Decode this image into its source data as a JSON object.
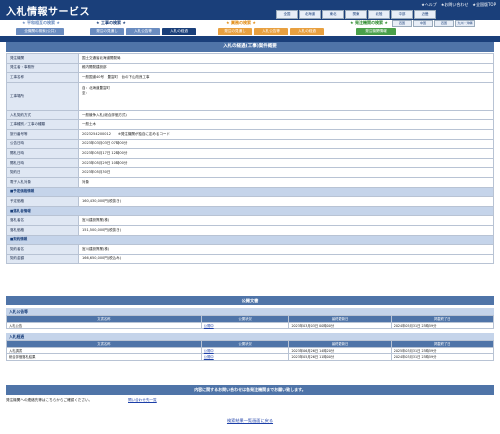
{
  "header": {
    "title": "入札情報サービス",
    "help": "★ヘルプ",
    "inquiry": "★お問い合わせ",
    "home": "★全国版TOP",
    "regions_row1": [
      "全国",
      "北海道",
      "東北",
      "関東",
      "北陸",
      "中部",
      "近畿"
    ],
    "regions_row2": [
      "四国",
      "中国",
      "四国",
      "九州・沖縄"
    ]
  },
  "nav": {
    "groups": [
      {
        "title": "★ 平和相互の検索 ★",
        "color": "#1a3f7a"
      },
      {
        "title": "★ 工事の検索 ★",
        "color": "#1a3f7a"
      },
      {
        "title": "★ 業務の検索 ★",
        "color": "#e08a10"
      },
      {
        "title": "★ 発注機関の検索 ★",
        "color": "#2a8a2a"
      }
    ],
    "tabs": [
      {
        "label": "全機関の検索(公共)",
        "color": "#6a8cc0"
      },
      {
        "label": "発注の見通し",
        "color": "#6a8cc0"
      },
      {
        "label": "入札公告等",
        "color": "#6a8cc0"
      },
      {
        "label": "入札の経過",
        "color": "#1a3f7a"
      },
      {
        "label": "発注の見通し",
        "color": "#e8a040"
      },
      {
        "label": "入札公告等",
        "color": "#e8a040"
      },
      {
        "label": "入札の経過",
        "color": "#e8a040"
      },
      {
        "label": "発注機関情報",
        "color": "#4aa04a"
      }
    ]
  },
  "page_heading": "入札の経過(工事)案件概要",
  "detail_rows": [
    {
      "label": "発注機関",
      "value": "国土交通省北海道開発局"
    },
    {
      "label": "発注者・事務所",
      "value": "稚内開発建設部"
    },
    {
      "label": "工事名称",
      "value": "一般国道40号　豊富町　台の下山改良工事"
    },
    {
      "label": "工事場所",
      "value": "自：北海道豊富町\n至："
    },
    {
      "label": "入札契約方式",
      "value": "一般競争入札(総合評価方式)"
    },
    {
      "label": "工事種別／工事の種類",
      "value": "一般土木"
    },
    {
      "label": "旅行番号等",
      "value": "2023254200012　　※発注機関が独自に定めるコード"
    },
    {
      "label": "公告日時",
      "value": "2023年03月03日 07時00分"
    },
    {
      "label": "開札日時",
      "value": "2023年05月17日 12時00分"
    },
    {
      "label": "開札日時",
      "value": "2023年05月29日 10時00分"
    },
    {
      "label": "契約日",
      "value": "2023年05月30日"
    },
    {
      "label": "電子入札対象",
      "value": "対象"
    },
    {
      "section": "■予定価格情報"
    },
    {
      "label": "予定価格",
      "value": "160,430,000円(税抜き)"
    },
    {
      "section": "■落札者情報"
    },
    {
      "label": "落札者名",
      "value": "宮川建設興業(株)"
    },
    {
      "label": "落札価格",
      "value": "151,500,000円(税抜き)"
    },
    {
      "section": "■契約情報"
    },
    {
      "label": "契約者名",
      "value": "宮川建設興業(株)"
    },
    {
      "label": "契約金額",
      "value": "166,650,000円(税込み)"
    }
  ],
  "public_docs": {
    "heading": "公開文書",
    "col_headers": [
      "文書名称",
      "公開状況",
      "最終更新日",
      "掲載終了日"
    ],
    "notice_section": "入札公告等",
    "notice_rows": [
      [
        "入札公告",
        "公開中",
        "2023年03月03日 00時00分",
        "2024年05月31日 23時59分"
      ]
    ],
    "progress_section": "入札経過",
    "progress_rows": [
      [
        "入札調書",
        "公開中",
        "2023年06月26日 14時20分",
        "2025年03月31日 23時59分"
      ],
      [
        "総合評価落札結果",
        "公開中",
        "2023年05月26日 11時00分",
        "2024年03月31日 23時59分"
      ]
    ]
  },
  "contact": {
    "heading": "内容に関するお問い合わせは各発注機関までお願い致します。",
    "text": "発注機関への連絡先等はこちらからご確認ください。",
    "link": "問い合わせ先一覧"
  },
  "back_link": "検索結果一覧画面に戻る"
}
